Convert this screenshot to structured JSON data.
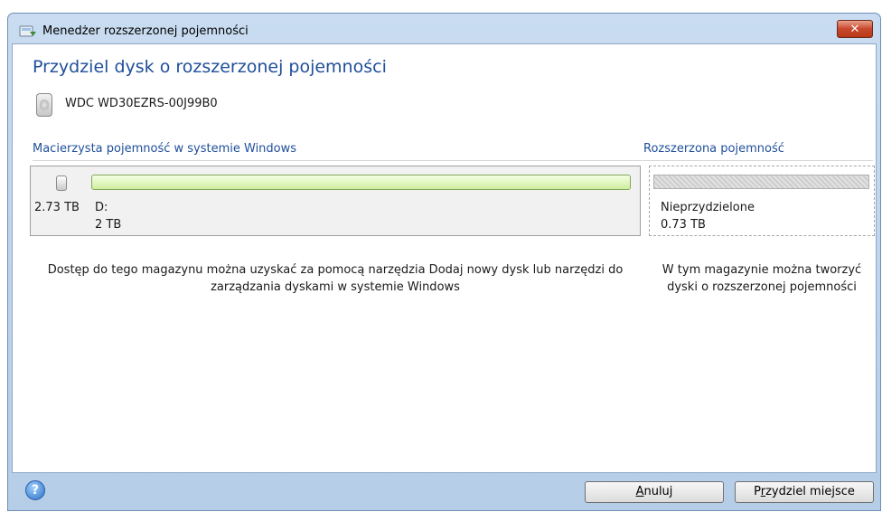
{
  "window": {
    "title": "Menedżer rozszerzonej pojemności",
    "close_label": "✕"
  },
  "heading": "Przydziel dysk o rozszerzonej pojemności",
  "disk": {
    "name": "WDC WD30EZRS-00J99B0"
  },
  "sections": {
    "native_label": "Macierzysta pojemność w systemie Windows",
    "extended_label": "Rozszerzona pojemność"
  },
  "native": {
    "total_size": "2.73 TB",
    "partition_letter": "D:",
    "partition_size": "2 TB",
    "description": "Dostęp do tego magazynu można uzyskać za pomocą narzędzia Dodaj nowy dysk lub narzędzi do zarządzania dyskami w systemie Windows"
  },
  "extended": {
    "label": "Nieprzydzielone",
    "size": "0.73 TB",
    "description": "W tym magazynie można tworzyć dyski o rozszerzonej pojemności"
  },
  "footer": {
    "help_label": "?",
    "cancel_first": "A",
    "cancel_rest": "nuluj",
    "allocate_pre": "P",
    "allocate_ul": "r",
    "allocate_rest": "zydziel miejsce"
  },
  "colors": {
    "accent": "#1f4f9a",
    "partition_fill": "#cfee9f",
    "unallocated": "#d6d6d6"
  },
  "icons": [
    "app-icon",
    "close-icon",
    "hard-disk-icon",
    "help-icon"
  ]
}
